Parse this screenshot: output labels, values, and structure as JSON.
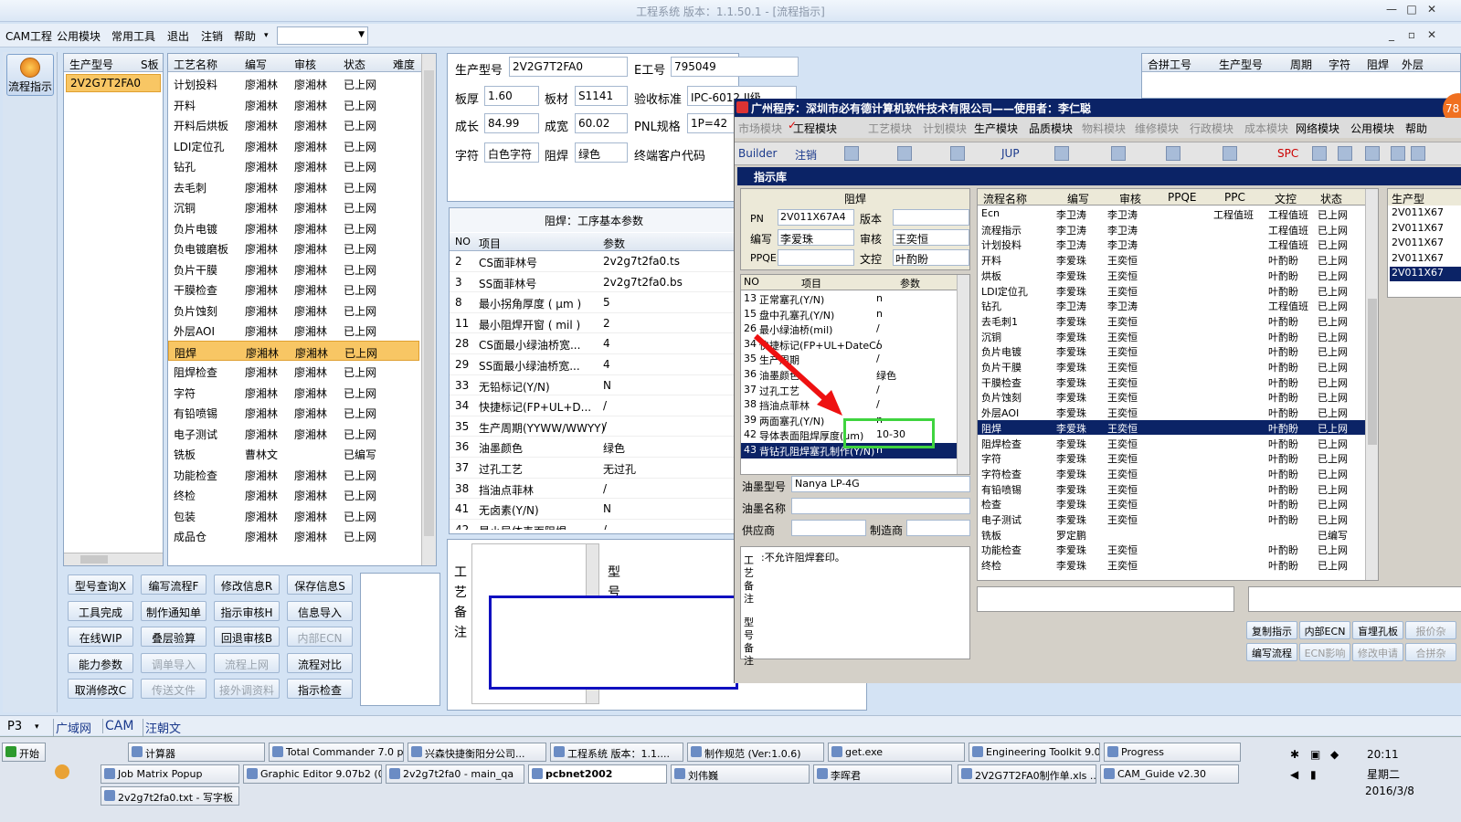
{
  "window": {
    "title": "工程系统   版本：1.1.50.1 - [流程指示]"
  },
  "menu": {
    "items": [
      "CAM工程",
      "公用模块",
      "常用工具",
      "退出",
      "注销",
      "帮助"
    ],
    "dropdown_arrow": "▾"
  },
  "lefttool": {
    "flow_button": "流程指示"
  },
  "model_list": {
    "headers": [
      "生产型号",
      "S板"
    ],
    "items": [
      "2V2G7T2FA0"
    ]
  },
  "process_table": {
    "headers": [
      "工艺名称",
      "编写",
      "审核",
      "状态",
      "难度"
    ],
    "rows": [
      [
        "计划投料",
        "廖湘林",
        "廖湘林",
        "已上网"
      ],
      [
        "开料",
        "廖湘林",
        "廖湘林",
        "已上网"
      ],
      [
        "开料后烘板",
        "廖湘林",
        "廖湘林",
        "已上网"
      ],
      [
        "LDI定位孔",
        "廖湘林",
        "廖湘林",
        "已上网"
      ],
      [
        "钻孔",
        "廖湘林",
        "廖湘林",
        "已上网"
      ],
      [
        "去毛刺",
        "廖湘林",
        "廖湘林",
        "已上网"
      ],
      [
        "沉铜",
        "廖湘林",
        "廖湘林",
        "已上网"
      ],
      [
        "负片电镀",
        "廖湘林",
        "廖湘林",
        "已上网"
      ],
      [
        "负电镀磨板",
        "廖湘林",
        "廖湘林",
        "已上网"
      ],
      [
        "负片干膜",
        "廖湘林",
        "廖湘林",
        "已上网"
      ],
      [
        "干膜检查",
        "廖湘林",
        "廖湘林",
        "已上网"
      ],
      [
        "负片蚀刻",
        "廖湘林",
        "廖湘林",
        "已上网"
      ],
      [
        "外层AOI",
        "廖湘林",
        "廖湘林",
        "已上网"
      ],
      [
        "阻焊",
        "廖湘林",
        "廖湘林",
        "已上网"
      ],
      [
        "阻焊检查",
        "廖湘林",
        "廖湘林",
        "已上网"
      ],
      [
        "字符",
        "廖湘林",
        "廖湘林",
        "已上网"
      ],
      [
        "有铅喷锡",
        "廖湘林",
        "廖湘林",
        "已上网"
      ],
      [
        "电子测试",
        "廖湘林",
        "廖湘林",
        "已上网"
      ],
      [
        "铣板",
        "曹林文",
        "",
        "已编写"
      ],
      [
        "功能检查",
        "廖湘林",
        "廖湘林",
        "已上网"
      ],
      [
        "终检",
        "廖湘林",
        "廖湘林",
        "已上网"
      ],
      [
        "包装",
        "廖湘林",
        "廖湘林",
        "已上网"
      ],
      [
        "成品仓",
        "廖湘林",
        "廖湘林",
        "已上网"
      ]
    ],
    "selected_index": 13
  },
  "buttons": [
    [
      "型号查询X",
      "编写流程F",
      "修改信息R",
      "保存信息S"
    ],
    [
      "工具完成",
      "制作通知单",
      "指示审核H",
      "信息导入"
    ],
    [
      "在线WIP",
      "叠层验算",
      "回退审核B",
      "内部ECN"
    ],
    [
      "能力参数",
      "调单导入",
      "流程上网",
      "流程对比"
    ],
    [
      "取消修改C",
      "传送文件",
      "接外调资料",
      "指示检查"
    ]
  ],
  "buttons_disabled": [
    "内部ECN",
    "调单导入",
    "流程上网",
    "传送文件",
    "接外调资料"
  ],
  "info": {
    "l_model": "生产型号",
    "model": "2V2G7T2FA0",
    "l_eno": "E工号",
    "eno": "795049",
    "l_thick": "板厚",
    "thick": "1.60",
    "l_mat": "板材",
    "mat": "S1141",
    "l_std": "验收标准",
    "std": "IPC-6012 II级",
    "l_len": "成长",
    "len": "84.99",
    "l_wid": "成宽",
    "wid": "60.02",
    "l_pnl": "PNL规格",
    "pnl": "1P=42",
    "l_char": "字符",
    "char": "白色字符",
    "l_mask": "阻焊",
    "mask": "绿色",
    "l_cust": "终端客户代码"
  },
  "params": {
    "title": "阻焊：工序基本参数",
    "headers": [
      "NO",
      "项目",
      "参数"
    ],
    "rows": [
      [
        "2",
        "CS面菲林号",
        "2v2g7t2fa0.ts"
      ],
      [
        "3",
        "SS面菲林号",
        "2v2g7t2fa0.bs"
      ],
      [
        "8",
        "最小拐角厚度 ( μm )",
        "5"
      ],
      [
        "11",
        "最小阻焊开窗 ( mil )",
        "2"
      ],
      [
        "28",
        "CS面最小绿油桥宽...",
        "4"
      ],
      [
        "29",
        "SS面最小绿油桥宽...",
        "4"
      ],
      [
        "33",
        "无铅标记(Y/N)",
        "N"
      ],
      [
        "34",
        "快捷标记(FP+UL+D...",
        "/"
      ],
      [
        "35",
        "生产周期(YYWW/WWYY)",
        "/"
      ],
      [
        "36",
        "油墨颜色",
        "绿色"
      ],
      [
        "37",
        "过孔工艺",
        "无过孔"
      ],
      [
        "38",
        "挡油点菲林",
        "/"
      ],
      [
        "41",
        "无卤素(Y/N)",
        "N"
      ],
      [
        "42",
        "最小导体表面阻焊...",
        "/"
      ]
    ]
  },
  "notes": {
    "craft": "工艺备注",
    "model": "型号"
  },
  "merge": {
    "headers": [
      "合拼工号",
      "生产型号",
      "周期",
      "字符",
      "阻焊",
      "外层"
    ]
  },
  "popup": {
    "title": "广州程序：深圳市必有德计算机软件技术有限公司——使用者：李仁聪",
    "menu": [
      "市场模块",
      "工程模块",
      "工艺模块",
      "计划模块",
      "生产模块",
      "品质模块",
      "物料模块",
      "维修模块",
      "行政模块",
      "成本模块",
      "网络模块",
      "公用模块",
      "帮助"
    ],
    "menu_checked": "✓",
    "toolbar": [
      "Builder",
      "注销",
      "JUP",
      "SPC"
    ],
    "subtitle": "指示库",
    "form": {
      "section": "阻焊",
      "l_pn": "PN",
      "pn": "2V011X67A4",
      "l_ver": "版本",
      "ver": "",
      "l_writer": "编写",
      "writer": "李爱珠",
      "l_review": "审核",
      "review": "王奕恒",
      "l_ppqe": "PPQE",
      "ppqe": "",
      "l_wc": "文控",
      "wc": "叶酌盼"
    },
    "ptable": {
      "headers": [
        "NO",
        "项目",
        "参数"
      ],
      "rows": [
        [
          "13",
          "正常塞孔(Y/N)",
          "n"
        ],
        [
          "15",
          "盘中孔塞孔(Y/N)",
          "n"
        ],
        [
          "26",
          "最小绿油桥(mil)",
          "/"
        ],
        [
          "34",
          "快捷标记(FP+UL+DateCo",
          "/"
        ],
        [
          "35",
          "生产周期",
          "/"
        ],
        [
          "36",
          "油墨颜色",
          "绿色"
        ],
        [
          "37",
          "过孔工艺",
          "/"
        ],
        [
          "38",
          "挡油点菲林",
          "/"
        ],
        [
          "39",
          "两面塞孔(Y/N)",
          "n"
        ],
        [
          "42",
          "导体表面阻焊厚度(um)",
          "10-30"
        ],
        [
          "43",
          "背钻孔阻焊塞孔制作(Y/N)",
          "n"
        ]
      ]
    },
    "ink": {
      "l_type": "油墨型号",
      "type": "Nanya LP-4G",
      "l_name": "油墨名称",
      "name": "",
      "l_sup": "供应商",
      "sup": "",
      "l_mfr": "制造商",
      "mfr": ""
    },
    "note_craft": "工艺备注",
    "note_text": ":不允许阻焊套印。",
    "note_model": "型号备注",
    "flow": {
      "headers": [
        "流程名称",
        "编写",
        "审核",
        "PPQE",
        "PPC",
        "文控",
        "状态"
      ],
      "rows": [
        [
          "Ecn",
          "李卫涛",
          "李卫涛",
          "",
          "工程值班",
          "工程值班",
          "已上网"
        ],
        [
          "流程指示",
          "李卫涛",
          "李卫涛",
          "",
          "",
          "工程值班",
          "已上网"
        ],
        [
          "计划投料",
          "李卫涛",
          "李卫涛",
          "",
          "",
          "工程值班",
          "已上网"
        ],
        [
          "开料",
          "李爱珠",
          "王奕恒",
          "",
          "",
          "叶酌盼",
          "已上网"
        ],
        [
          "烘板",
          "李爱珠",
          "王奕恒",
          "",
          "",
          "叶酌盼",
          "已上网"
        ],
        [
          "LDI定位孔",
          "李爱珠",
          "王奕恒",
          "",
          "",
          "叶酌盼",
          "已上网"
        ],
        [
          "钻孔",
          "李卫涛",
          "李卫涛",
          "",
          "",
          "工程值班",
          "已上网"
        ],
        [
          "去毛刺1",
          "李爱珠",
          "王奕恒",
          "",
          "",
          "叶酌盼",
          "已上网"
        ],
        [
          "沉铜",
          "李爱珠",
          "王奕恒",
          "",
          "",
          "叶酌盼",
          "已上网"
        ],
        [
          "负片电镀",
          "李爱珠",
          "王奕恒",
          "",
          "",
          "叶酌盼",
          "已上网"
        ],
        [
          "负片干膜",
          "李爱珠",
          "王奕恒",
          "",
          "",
          "叶酌盼",
          "已上网"
        ],
        [
          "干膜检查",
          "李爱珠",
          "王奕恒",
          "",
          "",
          "叶酌盼",
          "已上网"
        ],
        [
          "负片蚀刻",
          "李爱珠",
          "王奕恒",
          "",
          "",
          "叶酌盼",
          "已上网"
        ],
        [
          "外层AOI",
          "李爱珠",
          "王奕恒",
          "",
          "",
          "叶酌盼",
          "已上网"
        ],
        [
          "阻焊",
          "李爱珠",
          "王奕恒",
          "",
          "",
          "叶酌盼",
          "已上网"
        ],
        [
          "阻焊检查",
          "李爱珠",
          "王奕恒",
          "",
          "",
          "叶酌盼",
          "已上网"
        ],
        [
          "字符",
          "李爱珠",
          "王奕恒",
          "",
          "",
          "叶酌盼",
          "已上网"
        ],
        [
          "字符检查",
          "李爱珠",
          "王奕恒",
          "",
          "",
          "叶酌盼",
          "已上网"
        ],
        [
          "有铅喷锡",
          "李爱珠",
          "王奕恒",
          "",
          "",
          "叶酌盼",
          "已上网"
        ],
        [
          "检查",
          "李爱珠",
          "王奕恒",
          "",
          "",
          "叶酌盼",
          "已上网"
        ],
        [
          "电子测试",
          "李爱珠",
          "王奕恒",
          "",
          "",
          "叶酌盼",
          "已上网"
        ],
        [
          "铣板",
          "罗定鹏",
          "",
          "",
          "",
          "",
          "已编写"
        ],
        [
          "功能检查",
          "李爱珠",
          "王奕恒",
          "",
          "",
          "叶酌盼",
          "已上网"
        ],
        [
          "终检",
          "李爱珠",
          "王奕恒",
          "",
          "",
          "叶酌盼",
          "已上网"
        ]
      ],
      "selected_index": 14
    },
    "side": {
      "header": "生产型",
      "items": [
        "2V011X67",
        "2V011X67",
        "2V011X67",
        "2V011X67",
        "2V011X67"
      ]
    },
    "bottom_buttons": [
      "复制指示",
      "内部ECN",
      "盲埋孔板",
      "报价杂"
    ],
    "bottom_buttons2": [
      "编写流程",
      "ECN影响",
      "修改申请",
      "合拼杂"
    ],
    "badge": "78"
  },
  "statusbar": {
    "items": [
      "P3",
      "广域网",
      "CAM",
      "汪朝文"
    ]
  },
  "taskbar": {
    "start": "开始",
    "row1": [
      "计算器",
      "Total Commander 7.0 p...",
      "兴森快捷衡阳分公司...",
      "工程系统 版本：1.1....",
      "制作规范 (Ver:1.0.6)",
      "get.exe",
      "Engineering Toolkit 9.0...",
      "Progress"
    ],
    "row2": [
      "Job Matrix Popup",
      "Graphic Editor 9.07b2 (0...",
      "2v2g7t2fa0 - main_qa",
      "pcbnet2002",
      "刘伟巍",
      "李晖君",
      "2V2G7T2FA0制作单.xls ...",
      "CAM_Guide v2.30"
    ],
    "row3": [
      "2v2g7t2fa0.txt - 写字板"
    ],
    "clock": "20:11",
    "weekday": "星期二",
    "date": "2016/3/8"
  }
}
